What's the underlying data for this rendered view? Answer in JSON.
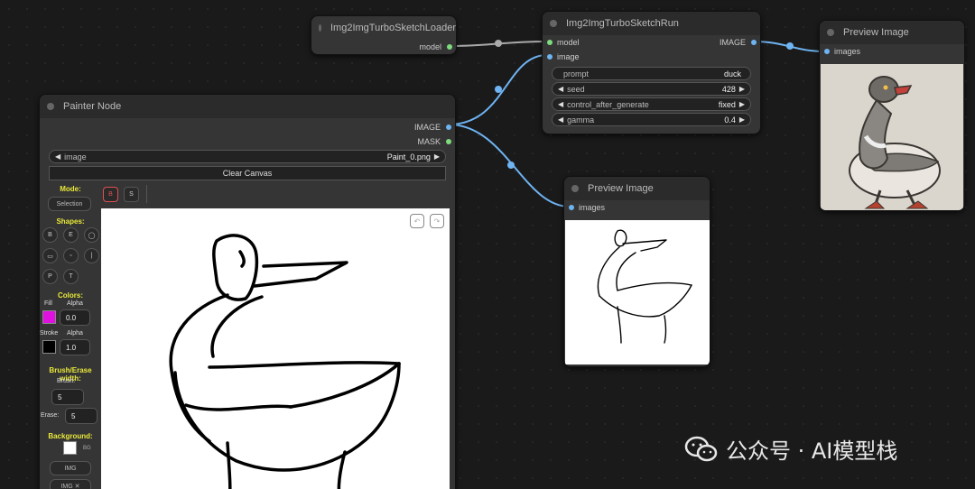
{
  "nodes": {
    "sketch_loader": {
      "title": "Img2ImgTurboSketchLoader",
      "output_label": "model"
    },
    "sketch_run": {
      "title": "Img2ImgTurboSketchRun",
      "input_model": "model",
      "input_image": "image",
      "output_label": "IMAGE",
      "widgets": [
        {
          "label": "prompt",
          "value": "duck"
        },
        {
          "label": "seed",
          "value": "428"
        },
        {
          "label": "control_after_generate",
          "value": "fixed"
        },
        {
          "label": "gamma",
          "value": "0.4"
        }
      ]
    },
    "preview_top": {
      "title": "Preview Image",
      "input_label": "images"
    },
    "preview_mid": {
      "title": "Preview Image",
      "input_label": "images"
    },
    "painter": {
      "title": "Painter Node",
      "output_image": "IMAGE",
      "output_mask": "MASK",
      "image_widget": {
        "label": "image",
        "value": "Paint_0.png"
      },
      "clear_canvas": "Clear Canvas",
      "mode_label": "Mode:",
      "mode_selection": "Selection",
      "brush_btn": "B",
      "select_btn": "S",
      "shapes_label": "Shapes:",
      "shapes": [
        "B",
        "E",
        "◯",
        "▭",
        "▫",
        "|",
        "P",
        "T"
      ],
      "colors_label": "Colors:",
      "fill_label": "Fill",
      "alpha_label": "Alpha",
      "fill_alpha": "0.0",
      "fill_color": "#e010e0",
      "stroke_label": "Stroke",
      "stroke_alpha": "1.0",
      "stroke_color": "#000000",
      "brush_erase_label": "Brush/Erase width:",
      "brush_label": "Brush:",
      "brush_value": "5",
      "erase_label": "Erase:",
      "erase_value": "5",
      "background_label": "Background:",
      "bg_small": "BG",
      "img_btn": "IMG",
      "img_x_btn": "IMG ✕"
    }
  },
  "colors": {
    "link_blue": "#6fb4f2",
    "link_gray": "#aaaaaa",
    "accent_yellow": "#eaea3a",
    "brush_active": "#e05050"
  },
  "watermark": "公众号 · AI模型栈"
}
